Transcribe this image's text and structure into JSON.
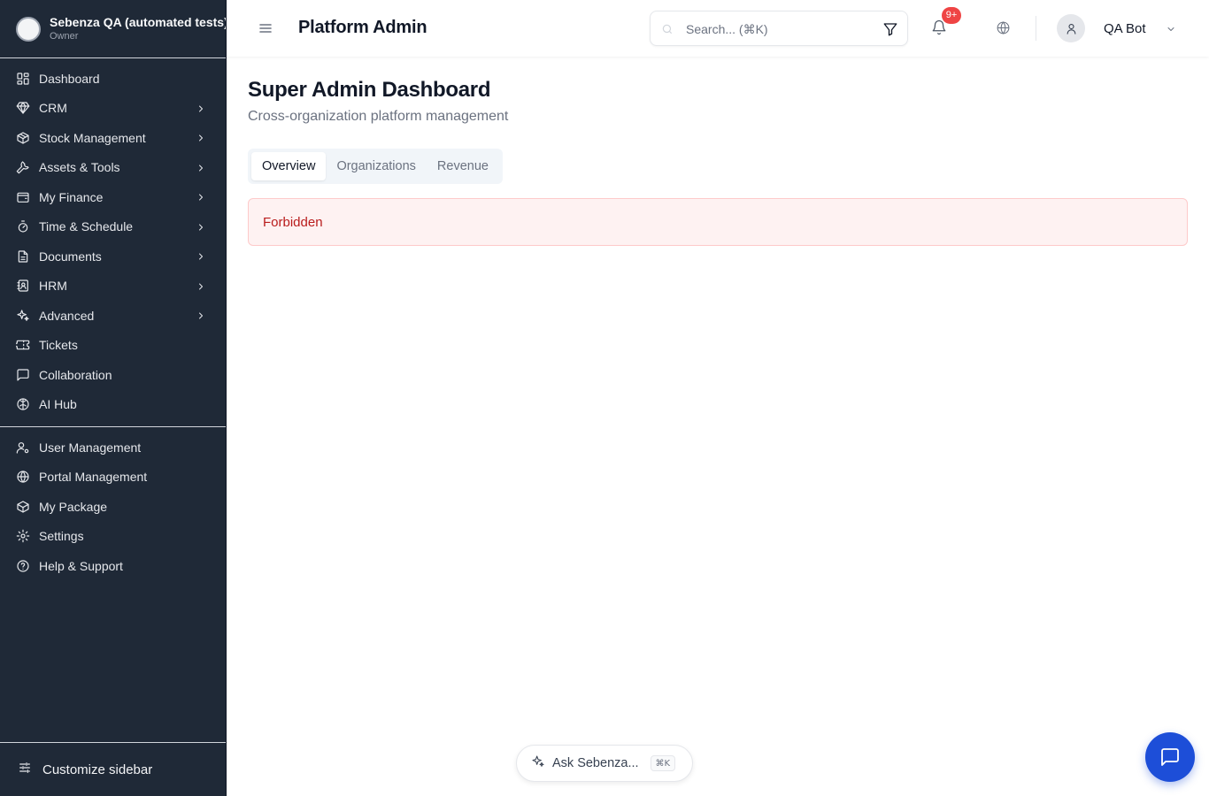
{
  "sidebar": {
    "org_name": "Sebenza QA (automated tests)",
    "org_role": "Owner",
    "items": [
      {
        "label": "Dashboard",
        "icon": "dashboard-icon",
        "has_submenu": false
      },
      {
        "label": "CRM",
        "icon": "gem-icon",
        "has_submenu": true
      },
      {
        "label": "Stock Management",
        "icon": "package-icon",
        "has_submenu": true
      },
      {
        "label": "Assets & Tools",
        "icon": "wrench-icon",
        "has_submenu": true
      },
      {
        "label": "My Finance",
        "icon": "wallet-icon",
        "has_submenu": true
      },
      {
        "label": "Time & Schedule",
        "icon": "timer-icon",
        "has_submenu": true
      },
      {
        "label": "Documents",
        "icon": "document-icon",
        "has_submenu": true
      },
      {
        "label": "HRM",
        "icon": "contact-book-icon",
        "has_submenu": true
      },
      {
        "label": "Advanced",
        "icon": "sparkles-icon",
        "has_submenu": true
      },
      {
        "label": "Tickets",
        "icon": "ticket-icon",
        "has_submenu": false
      },
      {
        "label": "Collaboration",
        "icon": "chat-icon",
        "has_submenu": false
      },
      {
        "label": "AI Hub",
        "icon": "brain-icon",
        "has_submenu": false
      }
    ],
    "bottom_items": [
      {
        "label": "User Management",
        "icon": "user-cog-icon"
      },
      {
        "label": "Portal Management",
        "icon": "globe-icon"
      },
      {
        "label": "My Package",
        "icon": "package-icon"
      },
      {
        "label": "Settings",
        "icon": "gear-icon"
      },
      {
        "label": "Help & Support",
        "icon": "help-circle-icon"
      }
    ],
    "customize_label": "Customize sidebar"
  },
  "header": {
    "title": "Platform Admin",
    "search_placeholder": "Search... (⌘K)",
    "notification_count": "9+",
    "user_name": "QA Bot"
  },
  "main": {
    "title": "Super Admin Dashboard",
    "subtitle": "Cross-organization platform management",
    "tabs": [
      {
        "label": "Overview",
        "active": true
      },
      {
        "label": "Organizations",
        "active": false
      },
      {
        "label": "Revenue",
        "active": false
      }
    ],
    "error_message": "Forbidden"
  },
  "assistant": {
    "label": "Ask Sebenza...",
    "shortcut": "⌘K"
  },
  "colors": {
    "sidebar_bg": "#1f2937",
    "accent": "#1d4ed8",
    "error_bg": "#fef2f2",
    "error_text": "#b91c1c",
    "badge": "#ef4444"
  }
}
